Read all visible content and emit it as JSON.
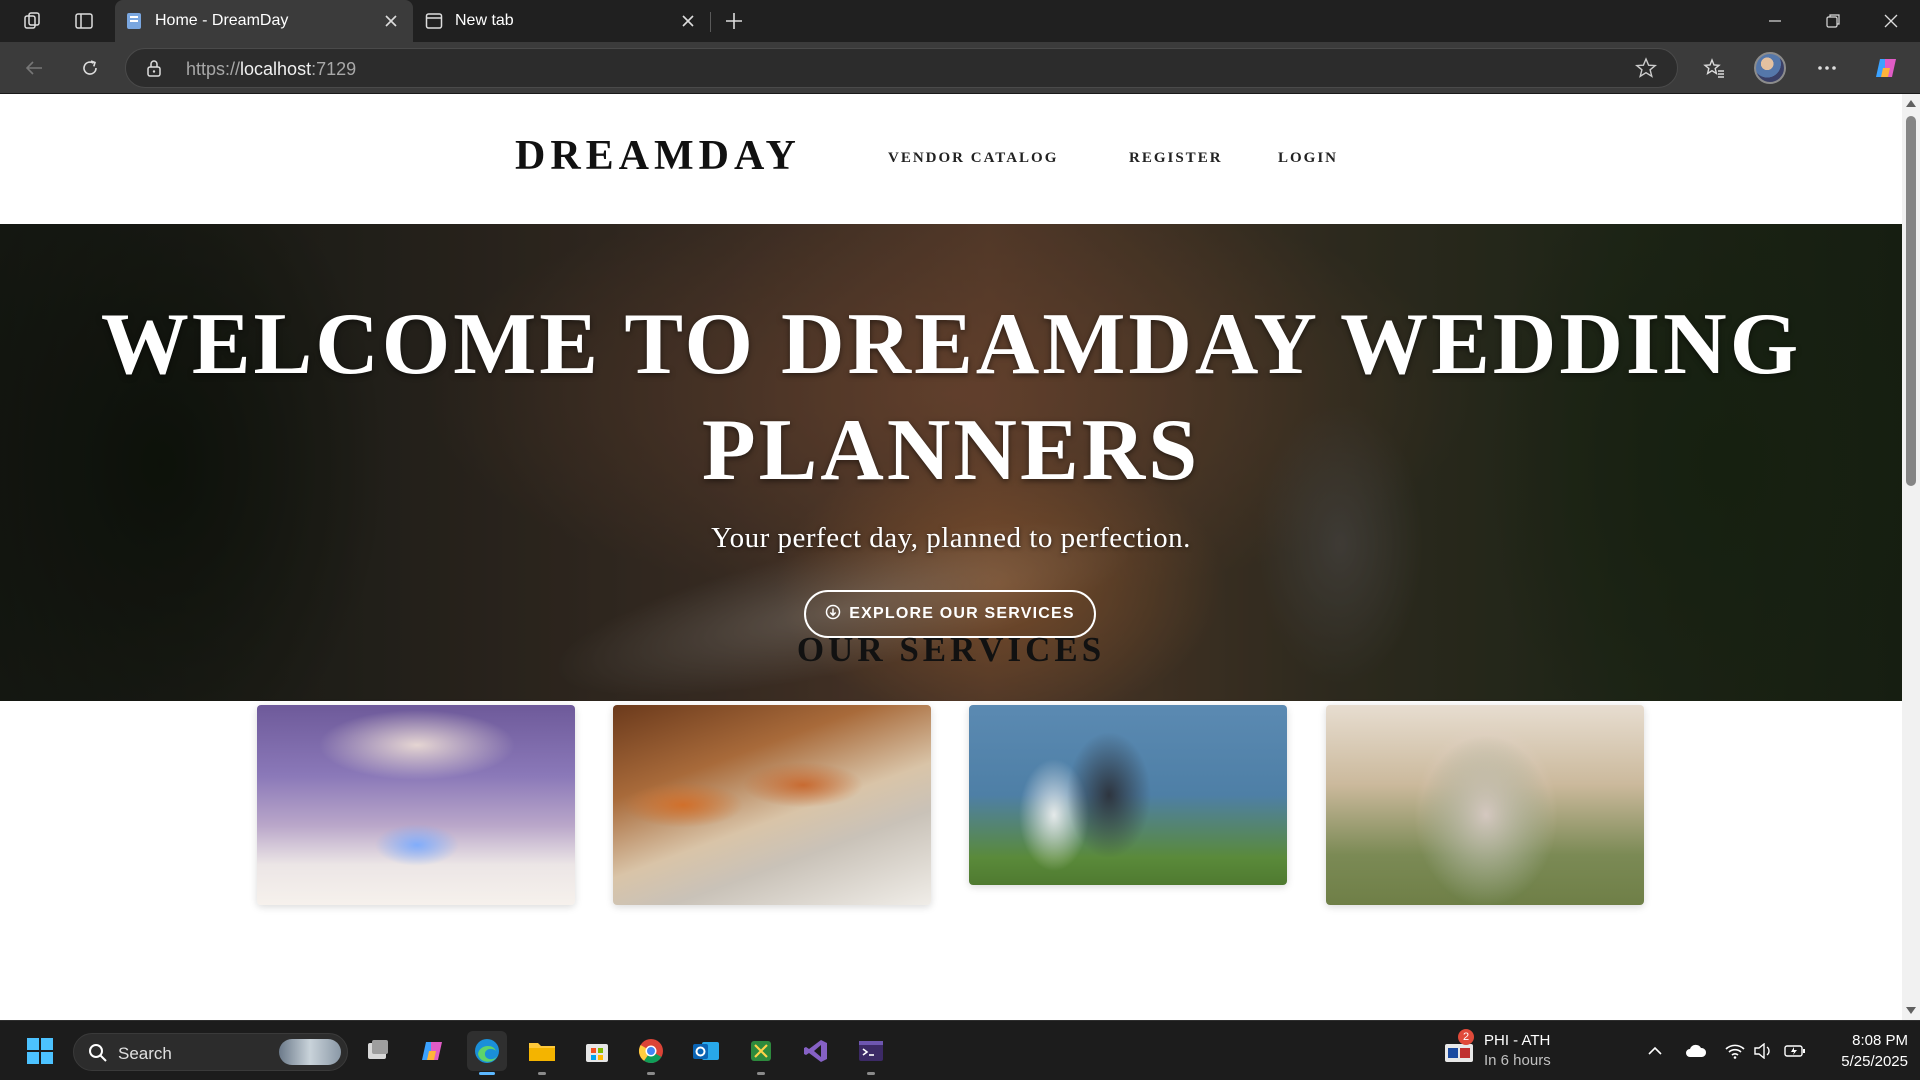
{
  "browser": {
    "tabs": [
      {
        "title": "Home - DreamDay",
        "active": true
      },
      {
        "title": "New tab",
        "active": false
      }
    ],
    "url_scheme": "https://",
    "url_host": "localhost",
    "url_port": ":7129"
  },
  "site": {
    "brand": "DREAMDAY",
    "nav": [
      "VENDOR CATALOG",
      "REGISTER",
      "LOGIN"
    ],
    "hero": {
      "title": "WELCOME TO DREAMDAY WEDDING PLANNERS",
      "subtitle": "Your perfect day, planned to perfection.",
      "button_label": "EXPLORE OUR SERVICES"
    },
    "services": {
      "heading": "OUR SERVICES"
    }
  },
  "taskbar": {
    "search_label": "Search",
    "weather_title": "PHI - ATH",
    "weather_sub": "In 6 hours",
    "weather_badge": "2",
    "time": "8:08 PM",
    "date": "5/25/2025"
  },
  "colors": {
    "accent": "#5cb8ff",
    "browser_chrome": "#202020",
    "page_bg": "#ffffff"
  }
}
